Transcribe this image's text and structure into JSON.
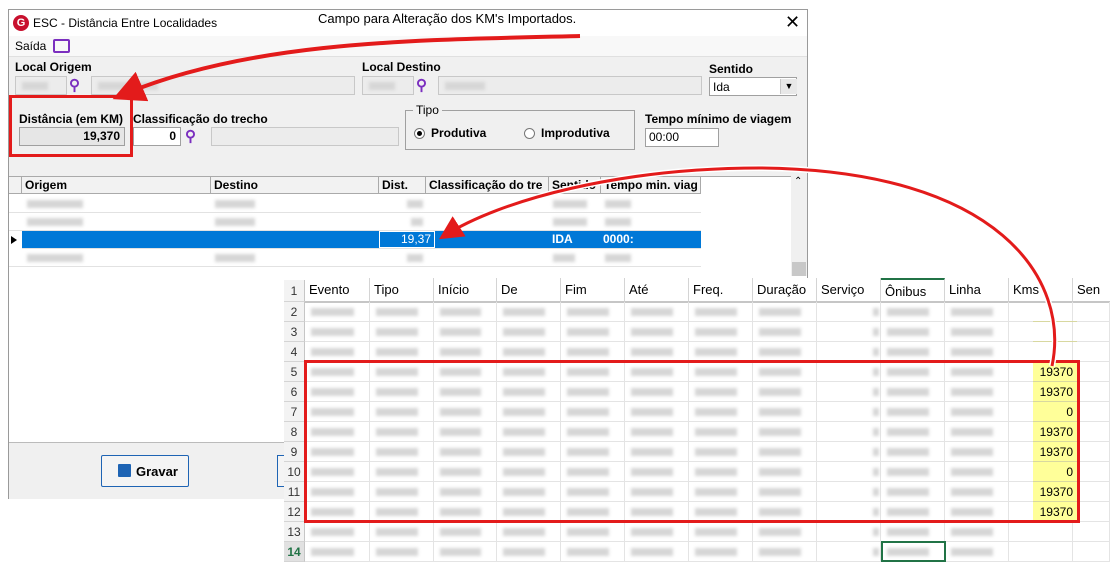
{
  "window": {
    "title": "ESC - Distância Entre Localidades",
    "close_glyph": "✕",
    "logo_letter": "G"
  },
  "menu": {
    "saida": "Saída"
  },
  "callout": "Campo para Alteração dos KM's Importados.",
  "form": {
    "local_origem_label": "Local Origem",
    "local_destino_label": "Local Destino",
    "sentido_label": "Sentido",
    "sentido_value": "Ida",
    "distancia_label": "Distância (em KM)",
    "distancia_value": "19,370",
    "classificacao_label": "Classificação do trecho",
    "classificacao_value": "0",
    "tipo_label": "Tipo",
    "tipo_options": [
      "Produtiva",
      "Improdutiva"
    ],
    "tipo_selected": "Produtiva",
    "tempo_label": "Tempo mínimo de viagem",
    "tempo_value": "00:00"
  },
  "grid": {
    "columns": [
      "Origem",
      "Destino",
      "Dist.",
      "Classificação do  tre",
      "Sentido",
      "Tempo min. viag"
    ],
    "selected_row": {
      "dist": "19,37",
      "sentido": "IDA",
      "tempo": "0000:"
    }
  },
  "buttons": {
    "gravar": "Gravar"
  },
  "excel": {
    "columns": [
      "Evento",
      "Tipo",
      "Início",
      "De",
      "Fim",
      "Até",
      "Freq.",
      "Duração",
      "Serviço",
      "Ônibus",
      "Linha",
      "Kms",
      "Sen"
    ],
    "rows": [
      {
        "n": "1"
      },
      {
        "n": "2",
        "kms": ""
      },
      {
        "n": "3",
        "kms": ""
      },
      {
        "n": "4",
        "kms": ""
      },
      {
        "n": "5",
        "kms": "19370"
      },
      {
        "n": "6",
        "kms": "19370"
      },
      {
        "n": "7",
        "kms": "0"
      },
      {
        "n": "8",
        "kms": "19370"
      },
      {
        "n": "9",
        "kms": "19370"
      },
      {
        "n": "10",
        "kms": "0"
      },
      {
        "n": "11",
        "kms": "19370"
      },
      {
        "n": "12",
        "kms": "19370"
      },
      {
        "n": "13",
        "kms": ""
      },
      {
        "n": "14",
        "kms": ""
      }
    ],
    "active_row": "14"
  },
  "colors": {
    "highlight": "#e31b1b",
    "selection": "#0078d7",
    "kms_fill": "#ffff99",
    "accent": "#7b2fbf"
  }
}
